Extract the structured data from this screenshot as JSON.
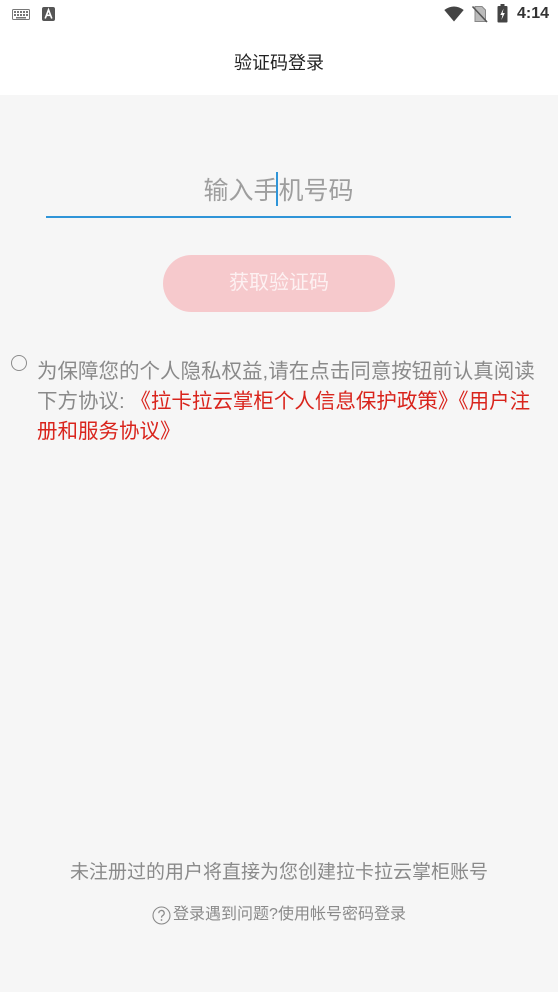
{
  "status_bar": {
    "left_icons": [
      "keyboard-icon",
      "app-notification-icon"
    ],
    "right_icons": [
      "wifi-icon",
      "no-sim-icon",
      "battery-charging-icon"
    ],
    "time": "4:14"
  },
  "header": {
    "title": "验证码登录"
  },
  "phone_input": {
    "placeholder": "输入手机号码",
    "value": ""
  },
  "get_code_button": {
    "label": "获取验证码"
  },
  "agreement": {
    "checked": false,
    "intro": "为保障您的个人隐私权益,请在点击同意按钮前认真阅读下方协议: ",
    "privacy_policy_link": "《拉卡拉云掌柜个人信息保护政策》",
    "user_agreement_link": "《用户注册和服务协议》"
  },
  "footer": {
    "notice": "未注册过的用户将直接为您创建拉卡拉云掌柜账号",
    "help_icon": "help-circle-icon",
    "help_link": "登录遇到问题?使用帐号密码登录"
  },
  "colors": {
    "accent": "#2f95d8",
    "button_bg": "#f6c9cc",
    "button_text": "#fdf1f2",
    "link": "#d9241c",
    "text_gray": "#8a8a8a",
    "background": "#f6f6f6"
  }
}
